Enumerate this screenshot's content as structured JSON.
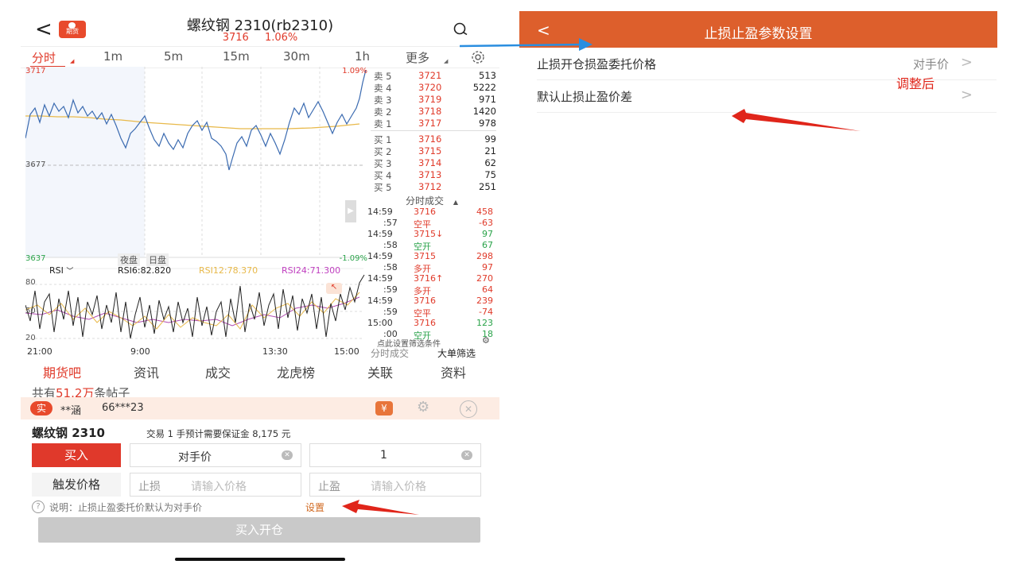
{
  "left": {
    "header": {
      "logo_text": "期货",
      "title": "螺纹钢 2310(rb2310)",
      "price": "3716",
      "change_pct": "1.06%"
    },
    "tabs": [
      {
        "label": "分时"
      },
      {
        "label": "1m"
      },
      {
        "label": "5m"
      },
      {
        "label": "15m"
      },
      {
        "label": "30m"
      },
      {
        "label": "1h"
      },
      {
        "label": "更多"
      }
    ],
    "chart_labels": {
      "price_high": "3717",
      "price_mid": "3677",
      "price_low": "3637",
      "pct_high": "1.09%",
      "pct_low": "-1.09%",
      "session_night": "夜盘",
      "session_day": "日盘",
      "rsi_selector": "RSI",
      "rsi6": "RSI6:82.820",
      "rsi12": "RSI12:78.370",
      "rsi24": "RSI24:71.300",
      "rsi_80": "80",
      "rsi_50": "50",
      "rsi_20": "20",
      "time_start": "21:00",
      "time_1": "9:00",
      "time_2": "13:30",
      "time_end": "15:00"
    },
    "order_book": {
      "asks": [
        {
          "label": "卖 5",
          "price": "3721",
          "vol": "513"
        },
        {
          "label": "卖 4",
          "price": "3720",
          "vol": "5222"
        },
        {
          "label": "卖 3",
          "price": "3719",
          "vol": "971"
        },
        {
          "label": "卖 2",
          "price": "3718",
          "vol": "1420"
        },
        {
          "label": "卖 1",
          "price": "3717",
          "vol": "978"
        }
      ],
      "bids": [
        {
          "label": "买 1",
          "price": "3716",
          "vol": "99"
        },
        {
          "label": "买 2",
          "price": "3715",
          "vol": "21"
        },
        {
          "label": "买 3",
          "price": "3714",
          "vol": "62"
        },
        {
          "label": "买 4",
          "price": "3713",
          "vol": "75"
        },
        {
          "label": "买 5",
          "price": "3712",
          "vol": "251"
        }
      ],
      "ticks_title": "分时成交",
      "ticks": [
        {
          "time": "14:59",
          "price": "3716",
          "vol": "458",
          "c": "red"
        },
        {
          "time": ":57",
          "price": "空平",
          "vol": "-63",
          "c": "red"
        },
        {
          "time": "14:59",
          "price": "3715↓",
          "vol": "97",
          "c": "green"
        },
        {
          "time": ":58",
          "price": "空开",
          "vol": "67",
          "c": "green"
        },
        {
          "time": "14:59",
          "price": "3715",
          "vol": "298",
          "c": "red"
        },
        {
          "time": ":58",
          "price": "多开",
          "vol": "97",
          "c": "red"
        },
        {
          "time": "14:59",
          "price": "3716↑",
          "vol": "270",
          "c": "red"
        },
        {
          "time": ":59",
          "price": "多开",
          "vol": "64",
          "c": "red"
        },
        {
          "time": "14:59",
          "price": "3716",
          "vol": "239",
          "c": "red"
        },
        {
          "time": ":59",
          "price": "空平",
          "vol": "-74",
          "c": "red"
        },
        {
          "time": "15:00",
          "price": "3716",
          "vol": "123",
          "c": "green"
        },
        {
          "time": ":00",
          "price": "空开",
          "vol": "18",
          "c": "green"
        }
      ],
      "filter_hint": "点此设置筛选条件",
      "tab_ticks": "分时成交",
      "tab_big": "大单筛选"
    },
    "bottom_tabs": [
      "期货吧",
      "资讯",
      "成交",
      "龙虎榜",
      "关联",
      "资料"
    ],
    "posts_prefix": "共有",
    "posts_count": "51.2万",
    "posts_suffix": "条帖子",
    "account": {
      "badge": "实",
      "name": "**涵",
      "id": "66***23",
      "yen": "¥"
    },
    "contract": {
      "name": "螺纹钢 2310",
      "margin_note": "交易 1 手预计需要保证金 8,175 元"
    },
    "order": {
      "buy_label": "买入",
      "price_type": "对手价",
      "qty": "1",
      "trigger_label": "触发价格",
      "stop_loss_label": "止损",
      "stop_loss_placeholder": "请输入价格",
      "take_profit_label": "止盈",
      "take_profit_placeholder": "请输入价格",
      "note": "说明：止损止盈委托价默认为对手价",
      "note_link": "设置",
      "submit": "买入开仓"
    }
  },
  "right": {
    "title": "止损止盈参数设置",
    "items": [
      {
        "label": "止损开仓损盈委托价格",
        "value": "对手价"
      },
      {
        "label": "默认止损止盈价差",
        "value": ""
      }
    ],
    "annotation": "调整后"
  },
  "colors": {
    "accent_red": "#e03a2a",
    "header_orange": "#dd5f2c",
    "price_line": "#3a6ab0",
    "avg_line": "#e8b94a",
    "arrow_red": "#e0251a",
    "arrow_blue": "#2a8ee0"
  }
}
